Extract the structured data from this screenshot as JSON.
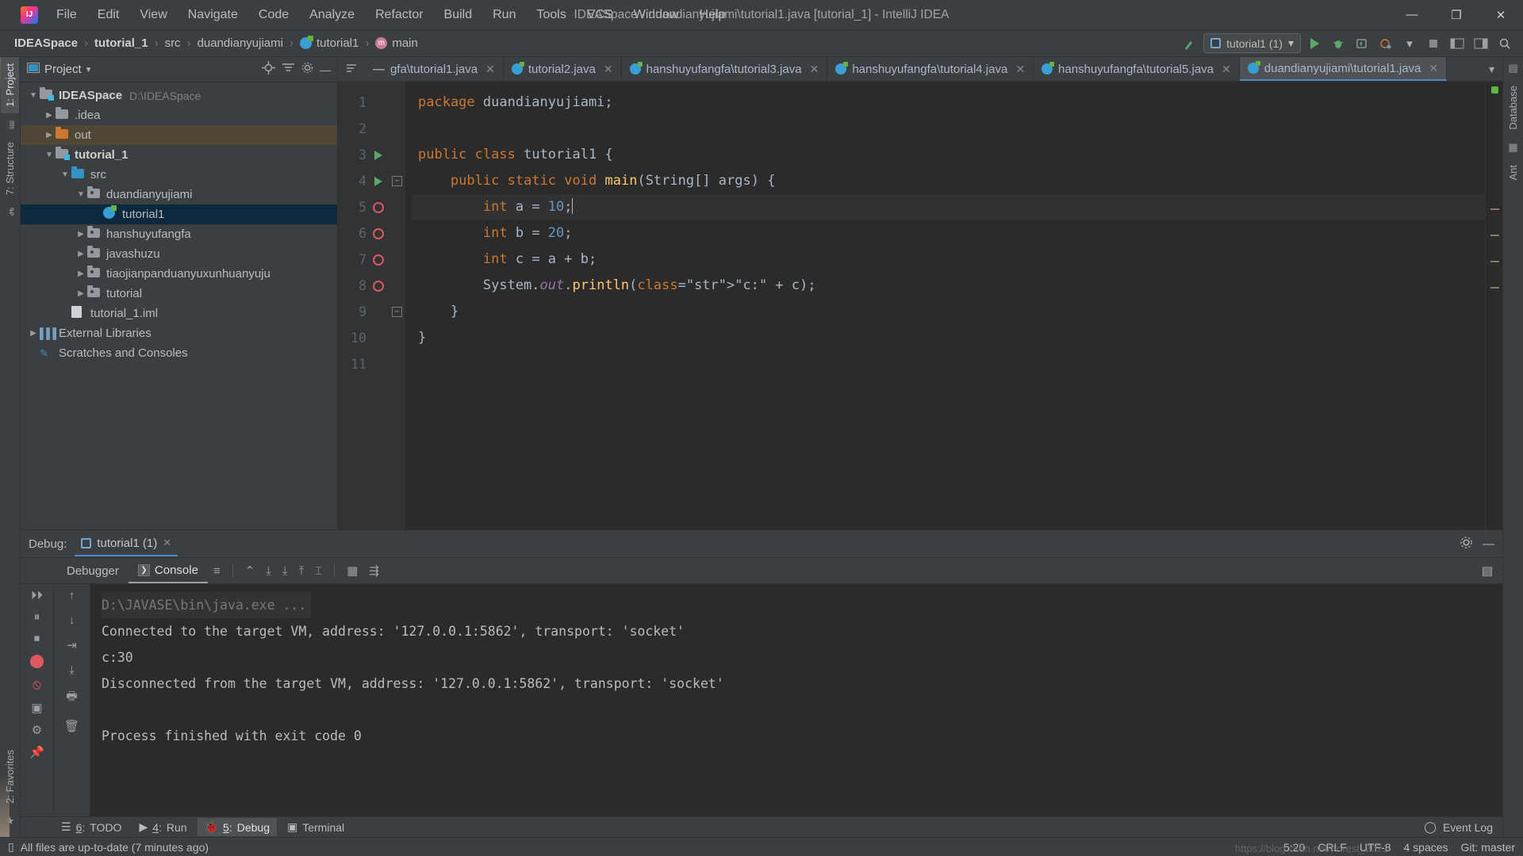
{
  "window": {
    "title": "IDEASpace - duandianyujiami\\tutorial1.java [tutorial_1] - IntelliJ IDEA",
    "minimize": "—",
    "maximize": "❐",
    "close": "✕"
  },
  "menu": {
    "items": [
      "File",
      "Edit",
      "View",
      "Navigate",
      "Code",
      "Analyze",
      "Refactor",
      "Build",
      "Run",
      "Tools",
      "VCS",
      "Window",
      "Help"
    ]
  },
  "navbar": {
    "breadcrumbs": [
      {
        "label": "IDEASpace",
        "icon": "none"
      },
      {
        "label": "tutorial_1",
        "icon": "none"
      },
      {
        "label": "src",
        "icon": "none"
      },
      {
        "label": "duandianyujiami",
        "icon": "none"
      },
      {
        "label": "tutorial1",
        "icon": "class-icon"
      },
      {
        "label": "main",
        "icon": "method-icon"
      }
    ],
    "separator": "›",
    "run_config": "tutorial1 (1)",
    "dropdown_caret": "▾"
  },
  "project_pane": {
    "title": "Project",
    "caret": "▾",
    "tree": [
      {
        "depth": 0,
        "arrow": "▼",
        "icon": "module-folder",
        "label": "IDEASpace",
        "path": "D:\\IDEASpace",
        "bold": true,
        "state": "normal"
      },
      {
        "depth": 1,
        "arrow": "▶",
        "icon": "folder",
        "label": ".idea",
        "path": "",
        "bold": false,
        "state": "normal"
      },
      {
        "depth": 1,
        "arrow": "▶",
        "icon": "folder-orange",
        "label": "out",
        "path": "",
        "bold": false,
        "state": "highlight"
      },
      {
        "depth": 1,
        "arrow": "▼",
        "icon": "module-folder",
        "label": "tutorial_1",
        "path": "",
        "bold": true,
        "state": "normal"
      },
      {
        "depth": 2,
        "arrow": "▼",
        "icon": "folder-blue",
        "label": "src",
        "path": "",
        "bold": false,
        "state": "normal"
      },
      {
        "depth": 3,
        "arrow": "▼",
        "icon": "package",
        "label": "duandianyujiami",
        "path": "",
        "bold": false,
        "state": "normal"
      },
      {
        "depth": 4,
        "arrow": "",
        "icon": "class-icon",
        "label": "tutorial1",
        "path": "",
        "bold": false,
        "state": "selected"
      },
      {
        "depth": 3,
        "arrow": "▶",
        "icon": "package",
        "label": "hanshuyufangfa",
        "path": "",
        "bold": false,
        "state": "normal"
      },
      {
        "depth": 3,
        "arrow": "▶",
        "icon": "package",
        "label": "javashuzu",
        "path": "",
        "bold": false,
        "state": "normal"
      },
      {
        "depth": 3,
        "arrow": "▶",
        "icon": "package",
        "label": "tiaojianpanduanyuxunhuanyuju",
        "path": "",
        "bold": false,
        "state": "normal"
      },
      {
        "depth": 3,
        "arrow": "▶",
        "icon": "package",
        "label": "tutorial",
        "path": "",
        "bold": false,
        "state": "normal"
      },
      {
        "depth": 2,
        "arrow": "",
        "icon": "file",
        "label": "tutorial_1.iml",
        "path": "",
        "bold": false,
        "state": "normal"
      },
      {
        "depth": 0,
        "arrow": "▶",
        "icon": "library",
        "label": "External Libraries",
        "path": "",
        "bold": false,
        "state": "normal"
      },
      {
        "depth": 0,
        "arrow": "",
        "icon": "scratch",
        "label": "Scratches and Consoles",
        "path": "",
        "bold": false,
        "state": "normal"
      }
    ]
  },
  "editor_tabs": [
    {
      "label": "gfa\\tutorial1.java",
      "icon": "dash-icon",
      "active": false
    },
    {
      "label": "tutorial2.java",
      "icon": "class-icon",
      "active": false
    },
    {
      "label": "hanshuyufangfa\\tutorial3.java",
      "icon": "class-icon",
      "active": false
    },
    {
      "label": "hanshuyufangfa\\tutorial4.java",
      "icon": "class-icon",
      "active": false
    },
    {
      "label": "hanshuyufangfa\\tutorial5.java",
      "icon": "class-icon",
      "active": false
    },
    {
      "label": "duandianyujiami\\tutorial1.java",
      "icon": "class-icon",
      "active": true
    }
  ],
  "editor": {
    "lines": [
      {
        "num": "1",
        "marker": "none",
        "fold": false,
        "current": false
      },
      {
        "num": "2",
        "marker": "none",
        "fold": false,
        "current": false
      },
      {
        "num": "3",
        "marker": "run",
        "fold": false,
        "current": false
      },
      {
        "num": "4",
        "marker": "run",
        "fold": true,
        "current": false
      },
      {
        "num": "5",
        "marker": "breakpoint",
        "fold": false,
        "current": true
      },
      {
        "num": "6",
        "marker": "breakpoint",
        "fold": false,
        "current": false
      },
      {
        "num": "7",
        "marker": "breakpoint",
        "fold": false,
        "current": false
      },
      {
        "num": "8",
        "marker": "breakpoint",
        "fold": false,
        "current": false
      },
      {
        "num": "9",
        "marker": "none",
        "fold": true,
        "current": false
      },
      {
        "num": "10",
        "marker": "none",
        "fold": false,
        "current": false
      },
      {
        "num": "11",
        "marker": "none",
        "fold": false,
        "current": false
      }
    ],
    "source_text": [
      "package duandianyujiami;",
      "",
      "public class tutorial1 {",
      "    public static void main(String[] args) {",
      "        int a = 10;",
      "        int b = 20;",
      "        int c = a + b;",
      "        System.out.println(\"c:\" + c);",
      "    }",
      "}",
      ""
    ]
  },
  "debug_pane": {
    "label": "Debug:",
    "session_tab": "tutorial1 (1)",
    "close": "✕",
    "tabs": [
      {
        "label": "Debugger",
        "selected": false
      },
      {
        "label": "Console",
        "selected": true
      }
    ],
    "console_lines": [
      {
        "text": "D:\\JAVASE\\bin\\java.exe ...",
        "style": "dim"
      },
      {
        "text": "Connected to the target VM, address: '127.0.0.1:5862', transport: 'socket'",
        "style": "normal"
      },
      {
        "text": "c:30",
        "style": "normal"
      },
      {
        "text": "Disconnected from the target VM, address: '127.0.0.1:5862', transport: 'socket'",
        "style": "normal"
      },
      {
        "text": "",
        "style": "normal"
      },
      {
        "text": "Process finished with exit code 0",
        "style": "normal"
      }
    ]
  },
  "tool_windows": {
    "bottom": [
      {
        "num": "6",
        "label": "TODO",
        "icon": "list-icon",
        "selected": false
      },
      {
        "num": "4",
        "label": "Run",
        "icon": "play-icon",
        "selected": false
      },
      {
        "num": "5",
        "label": "Debug",
        "icon": "bug-icon",
        "selected": true
      },
      {
        "num": "",
        "label": "Terminal",
        "icon": "terminal-icon",
        "selected": false
      }
    ],
    "left": [
      "1: Project",
      "7: Structure",
      "2: Favorites"
    ],
    "right": [
      "Database",
      "Ant"
    ],
    "event_log": "Event Log"
  },
  "statusbar": {
    "message": "All files are up-to-date (7 minutes ago)",
    "caret_position": "5:20",
    "line_separator": "CRLF",
    "encoding": "UTF-8",
    "indent": "4 spaces",
    "branch": "Git: master",
    "watermark": "https://blog.csdn.net/Forest_2021"
  },
  "colors": {
    "accent": "#4a88c7",
    "keyword": "#cc7832",
    "number": "#6897bb",
    "string": "#6a8759",
    "field": "#9876aa",
    "breakpoint": "#db5860",
    "run_green": "#59a869",
    "selection": "#0d293e"
  }
}
